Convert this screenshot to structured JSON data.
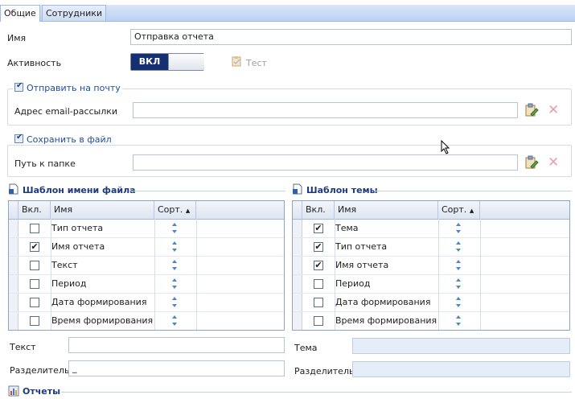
{
  "tabs": [
    {
      "label": "Общие",
      "active": true
    },
    {
      "label": "Сотрудники",
      "active": false
    }
  ],
  "general": {
    "name_label": "Имя",
    "name_value": "Отправка отчета",
    "activity_label": "Активность",
    "toggle_on_label": "ВКЛ",
    "test_label": "Тест"
  },
  "email_group": {
    "title": "Отправить на почту",
    "checked": true,
    "address_label": "Адрес email-рассылки",
    "address_value": ""
  },
  "file_group": {
    "title": "Сохранить в файл",
    "checked": true,
    "path_label": "Путь к папке",
    "path_value": ""
  },
  "filename_template": {
    "title": "Шаблон имени файла",
    "columns": [
      "Вкл.",
      "Имя",
      "Сорт."
    ],
    "rows": [
      {
        "checked": false,
        "name": "Тип отчета"
      },
      {
        "checked": true,
        "name": "Имя отчета"
      },
      {
        "checked": false,
        "name": "Текст"
      },
      {
        "checked": false,
        "name": "Период"
      },
      {
        "checked": false,
        "name": "Дата формирования"
      },
      {
        "checked": false,
        "name": "Время формирования"
      }
    ],
    "text_label": "Текст",
    "text_value": "",
    "separator_label": "Разделитель",
    "separator_value": "_"
  },
  "subject_template": {
    "title": "Шаблон темы",
    "columns": [
      "Вкл.",
      "Имя",
      "Сорт."
    ],
    "rows": [
      {
        "checked": true,
        "name": "Тема"
      },
      {
        "checked": true,
        "name": "Тип отчета"
      },
      {
        "checked": true,
        "name": "Имя отчета"
      },
      {
        "checked": false,
        "name": "Период"
      },
      {
        "checked": false,
        "name": "Дата формирования"
      },
      {
        "checked": false,
        "name": "Время формирования"
      }
    ],
    "subject_label": "Тема",
    "subject_value": "",
    "separator_label": "Разделитель",
    "separator_value": ""
  },
  "reports_section": {
    "title": "Отчеты"
  },
  "colors": {
    "accent": "#152f73",
    "group_title": "#1f4da0",
    "tab_bar": "#c9dbf4"
  }
}
